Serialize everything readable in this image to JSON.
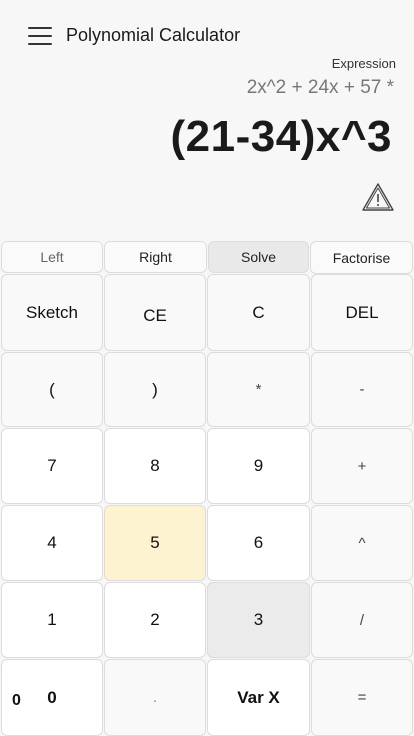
{
  "header": {
    "title": "Polynomial Calculator",
    "menu_icon": "hamburger-menu-icon"
  },
  "display": {
    "expression_label": "Expression",
    "expression_value": "2x^2 + 24x + 57 *",
    "main_value": "(21-34)x^3",
    "warning_icon": "warning-triangle-icon"
  },
  "tabs": {
    "left": "Left",
    "right": "Right",
    "solve": "Solve",
    "factorise": "Factorise"
  },
  "keys": {
    "sketch": "Sketch",
    "ce": "CE",
    "c": "C",
    "del": "DEL",
    "open_paren": "(",
    "close_paren": ")",
    "multiply": "*",
    "minus": "-",
    "seven": "7",
    "eight": "8",
    "nine": "9",
    "plus": "+",
    "four": "4",
    "five": "5",
    "six": "6",
    "power": "^",
    "one": "1",
    "two": "2",
    "three": "3",
    "divide": "/",
    "zero": "0",
    "dot": ".",
    "var_x": "Var X",
    "equals": "="
  },
  "side_text": "0",
  "colors": {
    "background": "#f7f7f7",
    "highlight_yellow": "#fdf3d0",
    "highlight_gray": "#ebebeb"
  }
}
